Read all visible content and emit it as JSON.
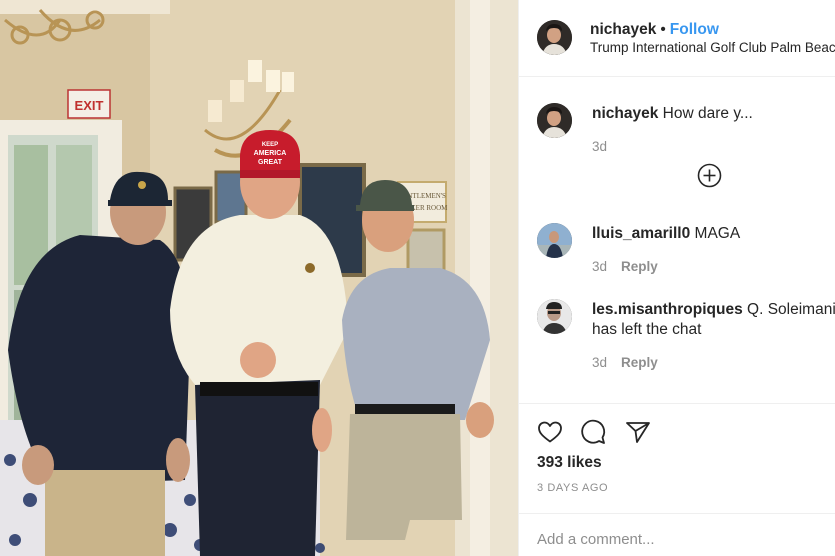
{
  "post": {
    "username": "nichayek",
    "separator": "•",
    "follow_label": "Follow",
    "location": "Trump International Golf Club Palm Beach",
    "photo": {
      "exit_sign": "EXIT",
      "cap_text": [
        "KEEP",
        "AMERICA",
        "GREAT"
      ],
      "door_sign": [
        "GENTLEMEN'S",
        "LOCKER ROOM"
      ]
    }
  },
  "comments": [
    {
      "username": "nichayek",
      "text": "How dare y...",
      "age": "3d",
      "reply_label": ""
    },
    {
      "username": "lluis_amarill0",
      "text": "MAGA",
      "age": "3d",
      "reply_label": "Reply"
    },
    {
      "username": "les.misanthropiques",
      "text": "Q. Soleimani",
      "text_line2": "has left the chat",
      "age": "3d",
      "reply_label": "Reply"
    }
  ],
  "icons": {
    "like": "heart-icon",
    "comment": "comment-icon",
    "share": "share-icon",
    "load_more": "plus-circle-icon"
  },
  "engagement": {
    "likes": "393 likes",
    "date": "3 DAYS AGO"
  },
  "composer": {
    "placeholder": "Add a comment..."
  },
  "colors": {
    "link_blue": "#3897f0",
    "text": "#262626",
    "muted": "#8e8e8e",
    "divider": "#efefef"
  }
}
